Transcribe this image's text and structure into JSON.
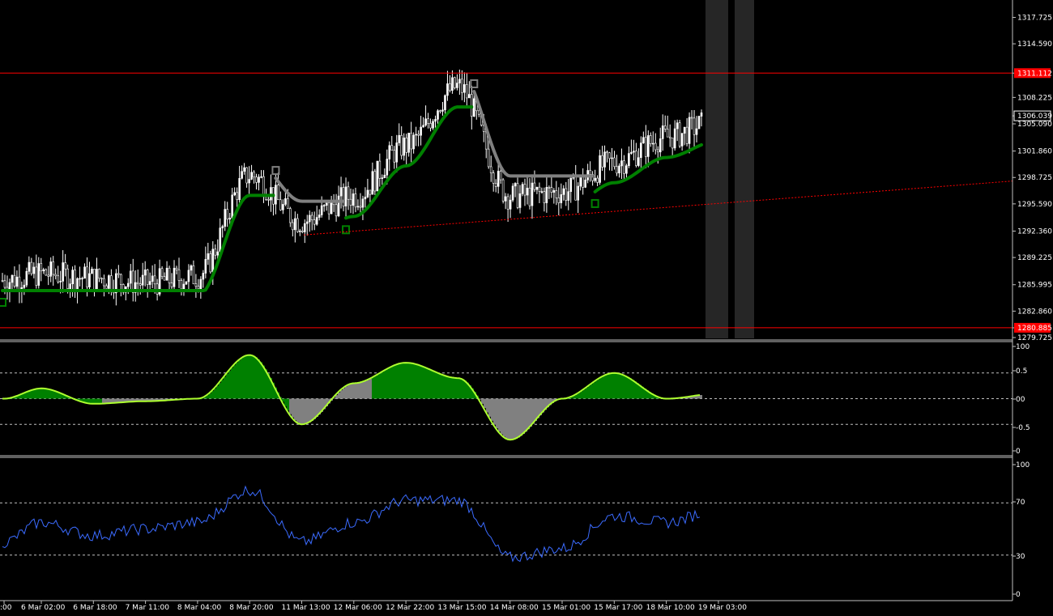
{
  "colors": {
    "background": "#000000",
    "axis": "#c0c0c0",
    "grid": "#c0c0c0",
    "hline": "#ff0000",
    "trend": "#ff0000",
    "candle": "#ffffff",
    "bull_band": "#008000",
    "bear_band": "#808080",
    "osc_green": "#008000",
    "osc_gray": "#808080",
    "osc_line": "#adff2f",
    "rsi_line": "#3b6bff",
    "session": "#2a2a2a"
  },
  "price_panel": {
    "ylim": [
      1279.725,
      1319.5
    ],
    "ticks": [
      "1317.725",
      "1314.590",
      "1311.112",
      "1308.225",
      "1306.039",
      "1305.090",
      "1301.860",
      "1298.725",
      "1295.590",
      "1292.360",
      "1289.225",
      "1285.995",
      "1282.860",
      "1280.885",
      "1279.725"
    ],
    "hline_high": {
      "value": 1311.112,
      "label": "1311.112"
    },
    "hline_low": {
      "value": 1280.885,
      "label": "1280.885"
    },
    "current_price": {
      "value": 1306.039,
      "label": "1306.039"
    }
  },
  "osc_panel": {
    "ylim": [
      -1,
      1
    ],
    "tick_labels": [
      "100",
      "0.5",
      "00",
      "-0.5",
      "0"
    ],
    "levels": [
      0.5,
      0,
      -0.5
    ]
  },
  "rsi_panel": {
    "ylim": [
      0,
      100
    ],
    "tick_labels": [
      "100",
      "70",
      "30",
      "0"
    ],
    "levels": [
      70,
      30
    ]
  },
  "time_axis": {
    "labels": [
      ":00",
      "6 Mar 02:00",
      "6 Mar 18:00",
      "7 Mar 11:00",
      "8 Mar 04:00",
      "8 Mar 20:00",
      "11 Mar 13:00",
      "12 Mar 06:00",
      "12 Mar 22:00",
      "13 Mar 15:00",
      "14 Mar 08:00",
      "15 Mar 01:00",
      "15 Mar 17:00",
      "18 Mar 10:00",
      "19 Mar 03:00"
    ]
  },
  "chart_data": {
    "type": "line",
    "categories": [
      "",
      "6 Mar 02:00",
      "6 Mar 18:00",
      "7 Mar 11:00",
      "8 Mar 04:00",
      "8 Mar 20:00",
      "11 Mar 13:00",
      "12 Mar 06:00",
      "12 Mar 22:00",
      "13 Mar 15:00",
      "14 Mar 08:00",
      "15 Mar 01:00",
      "15 Mar 17:00",
      "18 Mar 10:00",
      "19 Mar 03:00"
    ],
    "series": [
      {
        "values": [
          1286.5,
          1287.3,
          1286.8,
          1286.2,
          1287.0,
          1299.0,
          1293.5,
          1296.5,
          1302.5,
          1309.5,
          1296.5,
          1297.0,
          1300.5,
          1303.5,
          1305.5
        ]
      },
      {
        "values": [
          0.0,
          0.2,
          -0.1,
          -0.05,
          0.0,
          0.85,
          -0.5,
          0.3,
          0.7,
          0.4,
          -0.8,
          0.0,
          0.5,
          0.0,
          0.1
        ]
      },
      {
        "values": [
          40,
          55,
          45,
          50,
          55,
          80,
          40,
          55,
          72,
          72,
          28,
          35,
          60,
          55,
          65
        ]
      }
    ]
  }
}
